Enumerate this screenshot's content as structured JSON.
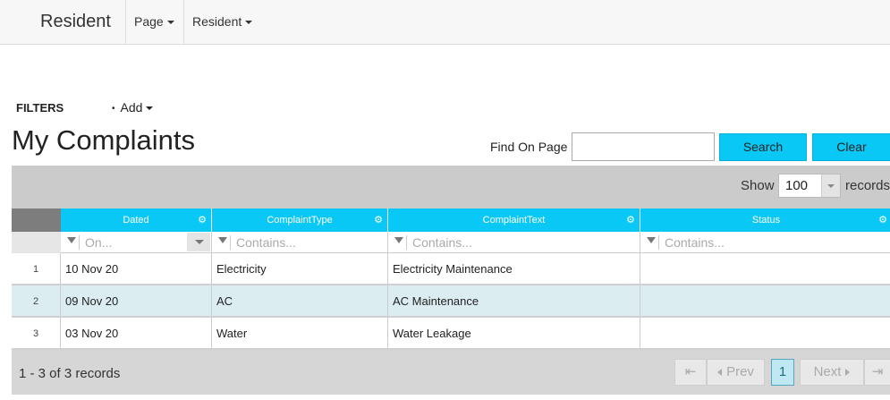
{
  "navbar": {
    "brand": "Resident",
    "menus": [
      {
        "label": "Page"
      },
      {
        "label": "Resident"
      }
    ]
  },
  "filters": {
    "label": "FILTERS",
    "add_label": "Add"
  },
  "page_title": "My Complaints",
  "search": {
    "find_label": "Find On Page",
    "value": "",
    "search_button": "Search",
    "clear_button": "Clear"
  },
  "grid": {
    "show_label": "Show",
    "page_size": "100",
    "records_label": "records",
    "columns": [
      {
        "label": "Dated",
        "filter_placeholder": "On..."
      },
      {
        "label": "ComplaintType",
        "filter_placeholder": "Contains..."
      },
      {
        "label": "ComplaintText",
        "filter_placeholder": "Contains..."
      },
      {
        "label": "Status",
        "filter_placeholder": "Contains..."
      }
    ],
    "rows": [
      {
        "num": "1",
        "dated": "10 Nov 20",
        "type": "Electricity",
        "text": "Electricity Maintenance",
        "status": ""
      },
      {
        "num": "2",
        "dated": "09 Nov 20",
        "type": "AC",
        "text": "AC Maintenance",
        "status": ""
      },
      {
        "num": "3",
        "dated": "03 Nov 20",
        "type": "Water",
        "text": "Water Leakage",
        "status": ""
      }
    ],
    "footer_count": "1 - 3 of 3 records",
    "pager": {
      "first": "⇤",
      "prev": "Prev",
      "current": "1",
      "next": "Next",
      "last": "⇥"
    }
  },
  "icons": {
    "gear": "gear-icon",
    "funnel": "filter-icon",
    "caret": "caret-down-icon"
  },
  "colors": {
    "accent": "#0ac8f5",
    "alt_row": "#dcedf2",
    "active_page": "#bfe8f2"
  }
}
